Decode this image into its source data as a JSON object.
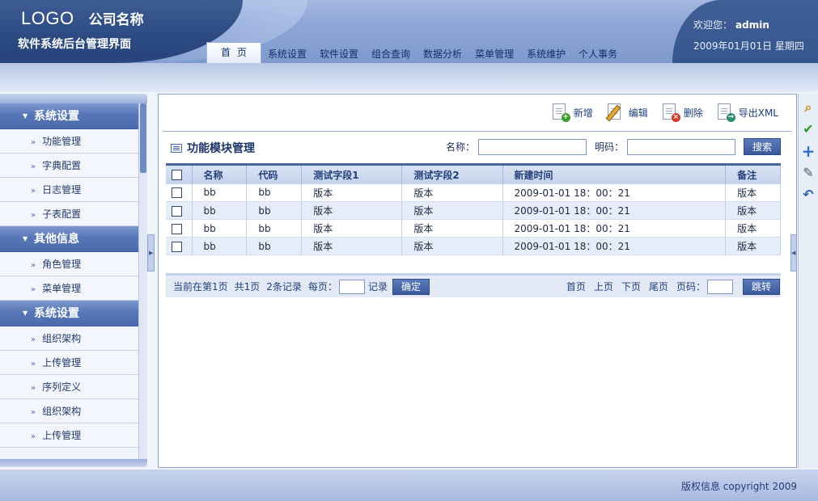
{
  "header": {
    "logo": "LOGO",
    "company": "公司名称",
    "subtitle": "软件系统后台管理界面",
    "welcome_label": "欢迎您：",
    "username": "admin",
    "date": "2009年01月01日 星期四"
  },
  "nav": {
    "tabs": [
      "首页",
      "系统设置",
      "软件设置",
      "组合查询",
      "数据分析",
      "菜单管理",
      "系统维护",
      "个人事务"
    ]
  },
  "sidebar": {
    "groups": [
      {
        "title": "系统设置",
        "items": [
          "功能管理",
          "字典配置",
          "日志管理",
          "子表配置"
        ]
      },
      {
        "title": "其他信息",
        "items": [
          "角色管理",
          "菜单管理"
        ]
      },
      {
        "title": "系统设置",
        "items": [
          "组织架构",
          "上传管理",
          "序列定义",
          "组织架构",
          "上传管理"
        ]
      }
    ]
  },
  "toolbar": {
    "add": "新增",
    "edit": "编辑",
    "delete": "删除",
    "export": "导出XML"
  },
  "module": {
    "title": "功能模块管理",
    "name_label": "名称：",
    "code_label": "明码：",
    "name_value": "",
    "code_value": "",
    "search_button": "搜索"
  },
  "table": {
    "headers": [
      "名称",
      "代码",
      "测试字段1",
      "测试字段2",
      "新建时间",
      "备注"
    ],
    "rows": [
      [
        "bb",
        "bb",
        "版本",
        "版本",
        "2009-01-01  18：00：21",
        "版本"
      ],
      [
        "bb",
        "bb",
        "版本",
        "版本",
        "2009-01-01  18：00：21",
        "版本"
      ],
      [
        "bb",
        "bb",
        "版本",
        "版本",
        "2009-01-01  18：00：21",
        "版本"
      ],
      [
        "bb",
        "bb",
        "版本",
        "版本",
        "2009-01-01  18：00：21",
        "版本"
      ]
    ]
  },
  "pager": {
    "current": "当前在第1页",
    "total_pages": "共1页",
    "records": "2条记录",
    "per_page_label": "每页：",
    "per_page_value": "",
    "records_suffix": "记录",
    "confirm": "确定",
    "first": "首页",
    "prev": "上页",
    "next": "下页",
    "last": "尾页",
    "page_label": "页码：",
    "page_value": "",
    "jump": "跳转"
  },
  "right_bar": {
    "icons": [
      "search-zoom-icon",
      "check-icon",
      "plus-icon",
      "edit-note-icon",
      "undo-icon"
    ]
  },
  "footer": {
    "copyright": "版权信息 copyright 2009"
  },
  "colors": {
    "header_dark": "#2c4a82",
    "accent": "#46649e",
    "row_alt": "#e7edf8"
  }
}
